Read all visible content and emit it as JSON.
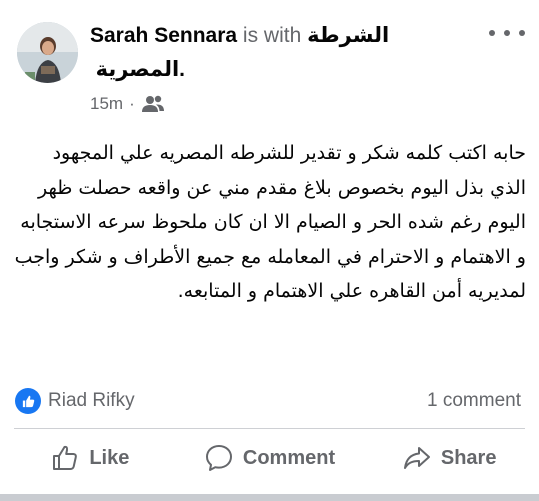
{
  "post": {
    "author": "Sarah Sennara",
    "with_text": "is with",
    "page_name_line1": "الشرطة",
    "page_name_line2": "المصرية.",
    "time": "15m",
    "separator": "·",
    "audience_icon": "friends-icon",
    "more_icon": "more-horizontal-icon",
    "body": "حابه اكتب كلمه شكر و تقدير للشرطه المصريه  علي المجهود الذي بذل اليوم بخصوص بلاغ مقدم مني عن واقعه حصلت ظهر اليوم رغم شده الحر و الصيام الا ان كان ملحوظ سرعه الاستجابه و الاهتمام و الاحترام في المعامله مع جميع الأطراف و شكر واجب لمديريه أمن القاهره علي الاهتمام و المتابعه."
  },
  "reactions": {
    "icon": "like-reaction-icon",
    "names": "Riad Rifky",
    "comment_count": "1 comment"
  },
  "actions": {
    "like_label": "Like",
    "comment_label": "Comment",
    "share_label": "Share"
  },
  "colors": {
    "text_primary": "#050505",
    "text_secondary": "#65676b",
    "like_blue": "#1877f2",
    "divider": "#ced0d4"
  }
}
